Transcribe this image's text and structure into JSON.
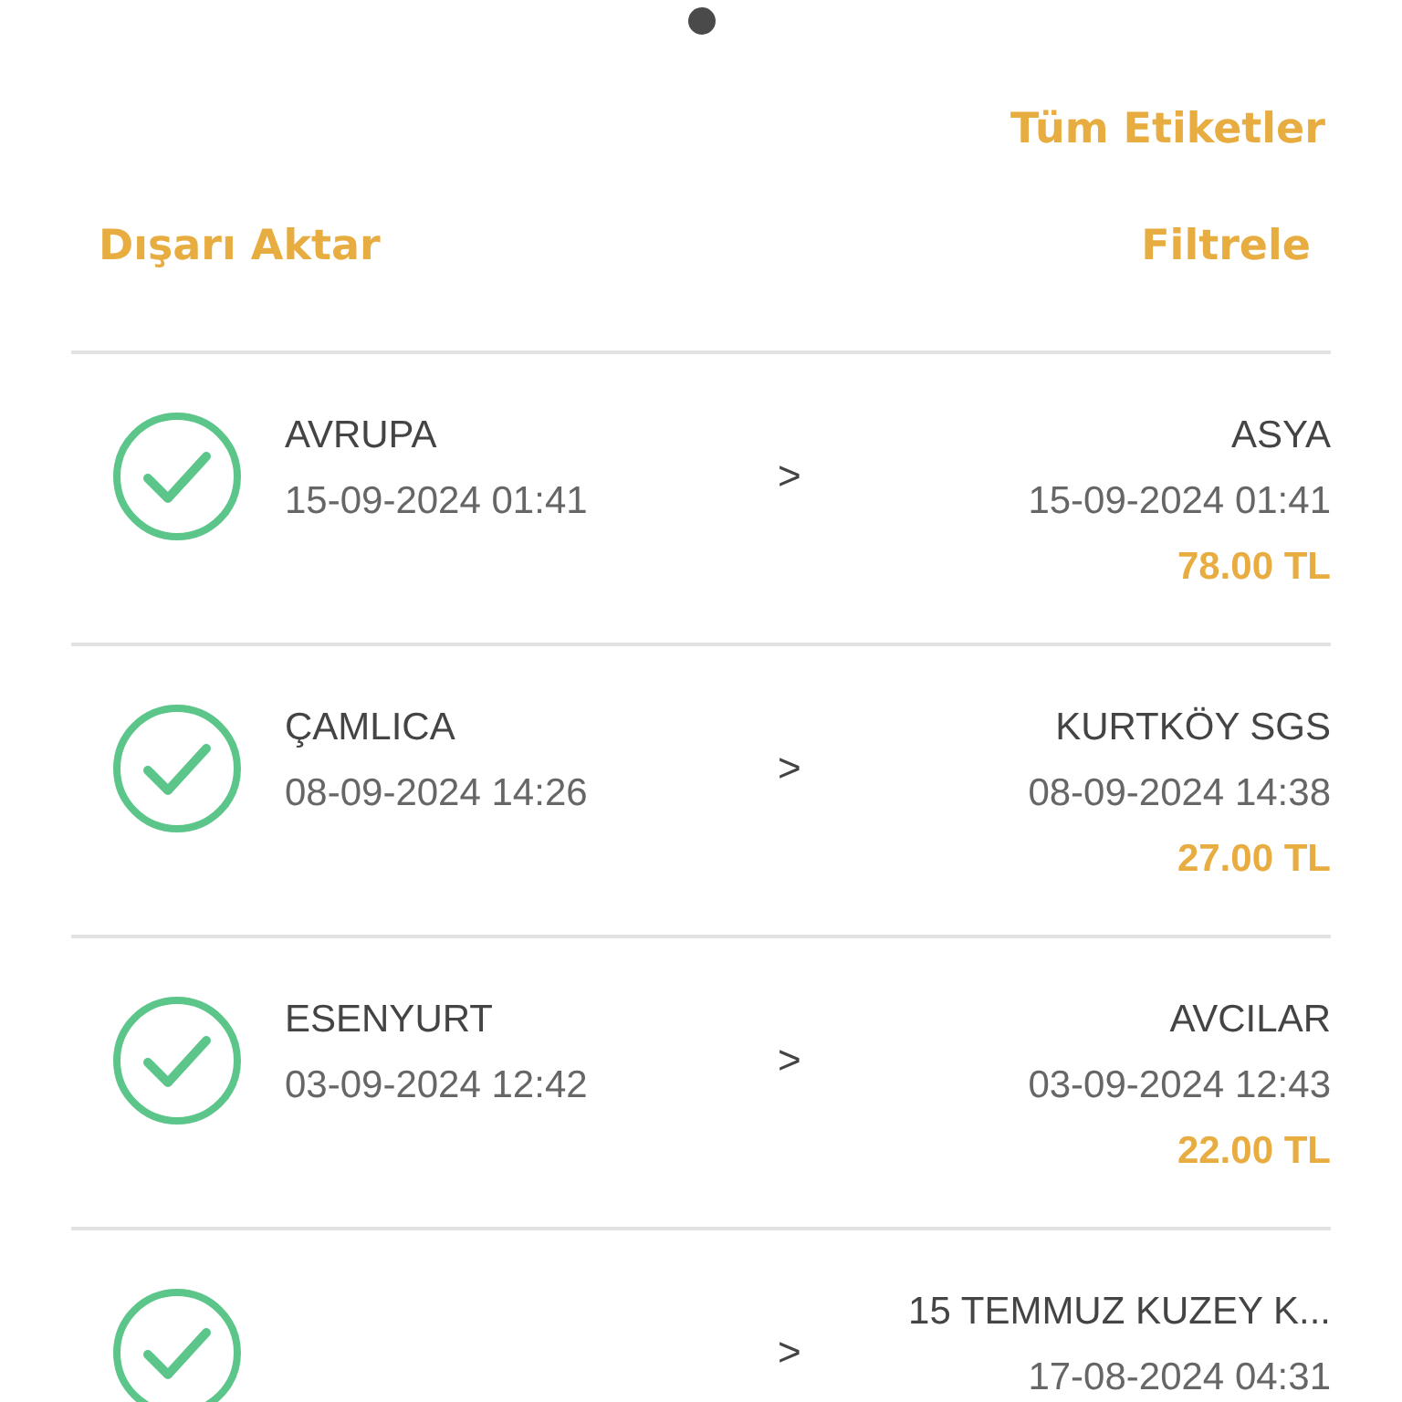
{
  "header": {
    "all_tags": "Tüm Etiketler",
    "export": "Dışarı Aktar",
    "filter": "Filtrele"
  },
  "trips": [
    {
      "from": "AVRUPA",
      "from_time": "15-09-2024 01:41",
      "separator": ">",
      "to": "ASYA",
      "to_time": "15-09-2024 01:41",
      "price": "78.00 TL"
    },
    {
      "from": "ÇAMLICA",
      "from_time": "08-09-2024 14:26",
      "separator": ">",
      "to": "KURTKÖY SGS",
      "to_time": "08-09-2024 14:38",
      "price": "27.00 TL"
    },
    {
      "from": "ESENYURT",
      "from_time": "03-09-2024 12:42",
      "separator": ">",
      "to": "AVCILAR",
      "to_time": "03-09-2024 12:43",
      "price": "22.00 TL"
    },
    {
      "separator": ">",
      "to": "15 TEMMUZ KUZEY K...",
      "to_time": "17-08-2024 04:31"
    }
  ]
}
